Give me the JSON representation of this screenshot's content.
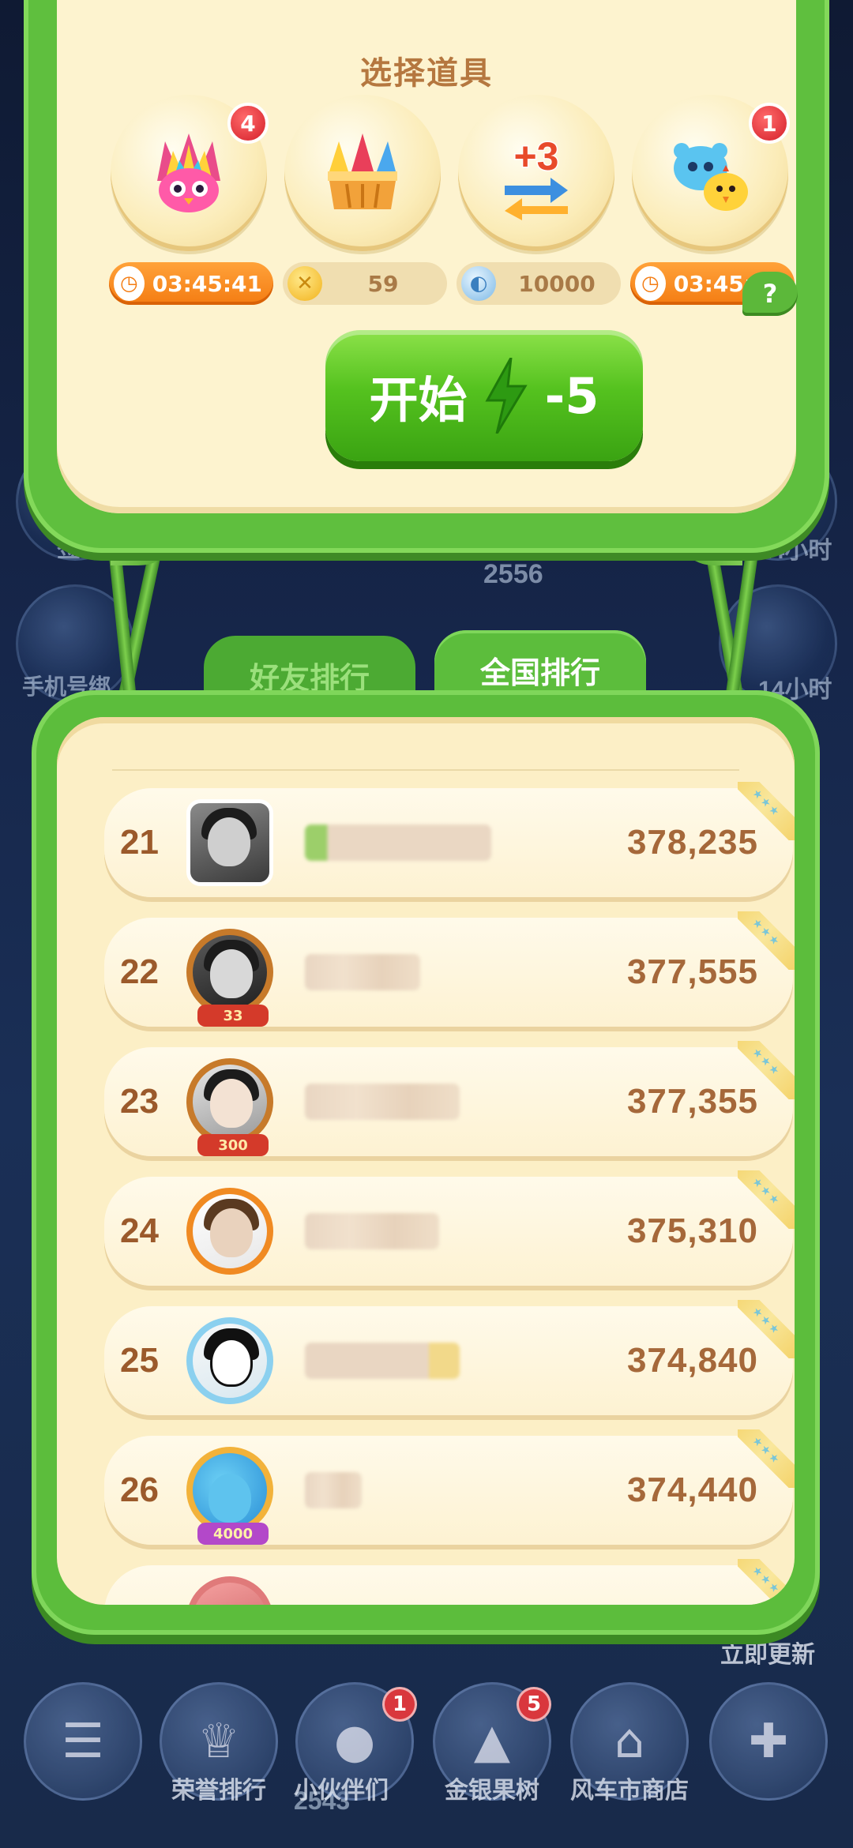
{
  "props": {
    "title": "选择道具",
    "items": [
      {
        "name": "rainbow-bird-icon",
        "badge": "4",
        "pill_type": "timer",
        "pill_text": "03:45:41",
        "pill_icon": "clock-icon"
      },
      {
        "name": "firework-bucket-icon",
        "badge": "",
        "pill_type": "cost",
        "pill_text": "59",
        "pill_icon": "gold-coin-icon"
      },
      {
        "name": "plus-three-swap-icon",
        "badge": "",
        "pill_type": "cost",
        "pill_text": "10000",
        "pill_icon": "silver-coin-icon"
      },
      {
        "name": "blue-bear-chick-icon",
        "badge": "1",
        "pill_type": "timer",
        "pill_text": "03:45:55",
        "pill_icon": "clock-icon"
      }
    ],
    "help": "?",
    "start": {
      "label": "开始",
      "energy_cost": "-5"
    }
  },
  "tabs": {
    "friends": "好友排行",
    "national": "全国排行",
    "active": "national"
  },
  "ranking": [
    {
      "rank": "21",
      "score": "378,235",
      "level": ""
    },
    {
      "rank": "22",
      "score": "377,555",
      "level": "33"
    },
    {
      "rank": "23",
      "score": "377,355",
      "level": "300"
    },
    {
      "rank": "24",
      "score": "375,310",
      "level": ""
    },
    {
      "rank": "25",
      "score": "374,840",
      "level": ""
    },
    {
      "rank": "26",
      "score": "374,440",
      "level": "4000"
    }
  ],
  "background": {
    "counter_1": "2556",
    "label_sign": "签",
    "label_phone": "手机号绑",
    "label_hours_1": "14小时",
    "label_hours_2": "14小时",
    "counter_2": "2543",
    "update": "立即更新"
  },
  "nav": [
    {
      "label": "",
      "icon": "menu-icon",
      "badge": ""
    },
    {
      "label": "荣誉排行",
      "icon": "crown-icon",
      "badge": ""
    },
    {
      "label": "小伙伴们",
      "icon": "raccoon-icon",
      "badge": "1"
    },
    {
      "label": "金银果树",
      "icon": "tree-icon",
      "badge": "5"
    },
    {
      "label": "风车市商店",
      "icon": "shop-icon",
      "badge": ""
    },
    {
      "label": "",
      "icon": "plus-icon",
      "badge": ""
    }
  ],
  "colors": {
    "primary_green": "#5cbd3c",
    "cream": "#fcefc6",
    "score_brown": "#a5683a",
    "timer_orange": "#f47c12",
    "badge_red": "#d41f2a"
  }
}
